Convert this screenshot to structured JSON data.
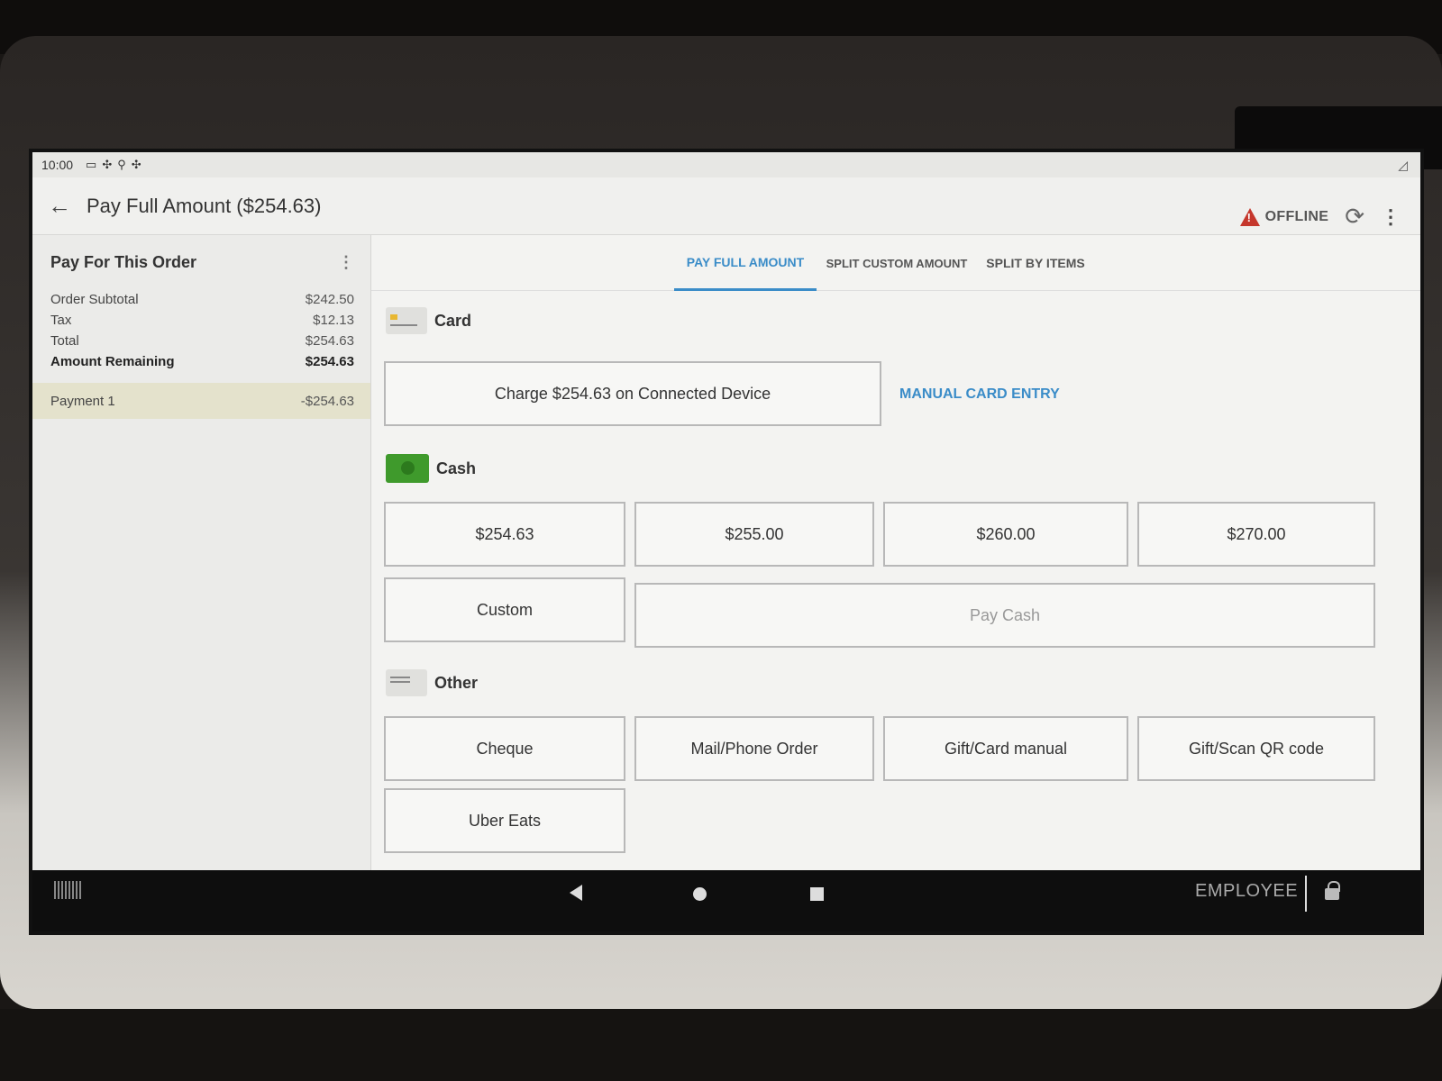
{
  "status_bar": {
    "time": "10:00",
    "icons": [
      "sim-icon",
      "app-icon",
      "usb-icon",
      "app-icon"
    ]
  },
  "app_bar": {
    "title": "Pay Full Amount ($254.63)",
    "offline_label": "OFFLINE"
  },
  "order_summary": {
    "title": "Pay For This Order",
    "rows": [
      {
        "label": "Order Subtotal",
        "value": "$242.50"
      },
      {
        "label": "Tax",
        "value": "$12.13"
      },
      {
        "label": "Total",
        "value": "$254.63"
      },
      {
        "label": "Amount Remaining",
        "value": "$254.63"
      }
    ],
    "payment": {
      "label": "Payment 1",
      "value": "-$254.63"
    }
  },
  "tabs": [
    {
      "label": "PAY FULL AMOUNT",
      "active": true
    },
    {
      "label": "SPLIT CUSTOM AMOUNT",
      "active": false
    },
    {
      "label": "SPLIT BY ITEMS",
      "active": false
    }
  ],
  "card": {
    "title": "Card",
    "charge_label": "Charge $254.63 on Connected Device",
    "manual_entry": "MANUAL CARD ENTRY"
  },
  "cash": {
    "title": "Cash",
    "amounts": [
      "$254.63",
      "$255.00",
      "$260.00",
      "$270.00"
    ],
    "custom_label": "Custom",
    "pay_cash_label": "Pay Cash"
  },
  "other": {
    "title": "Other",
    "options": [
      "Cheque",
      "Mail/Phone Order",
      "Gift/Card manual",
      "Gift/Scan QR code",
      "Uber Eats"
    ]
  },
  "nav_bar": {
    "employee_label": "EMPLOYEE"
  },
  "colors": {
    "accent": "#3a8cc8",
    "warning": "#c5372c",
    "cash_green": "#3f9a2c"
  }
}
